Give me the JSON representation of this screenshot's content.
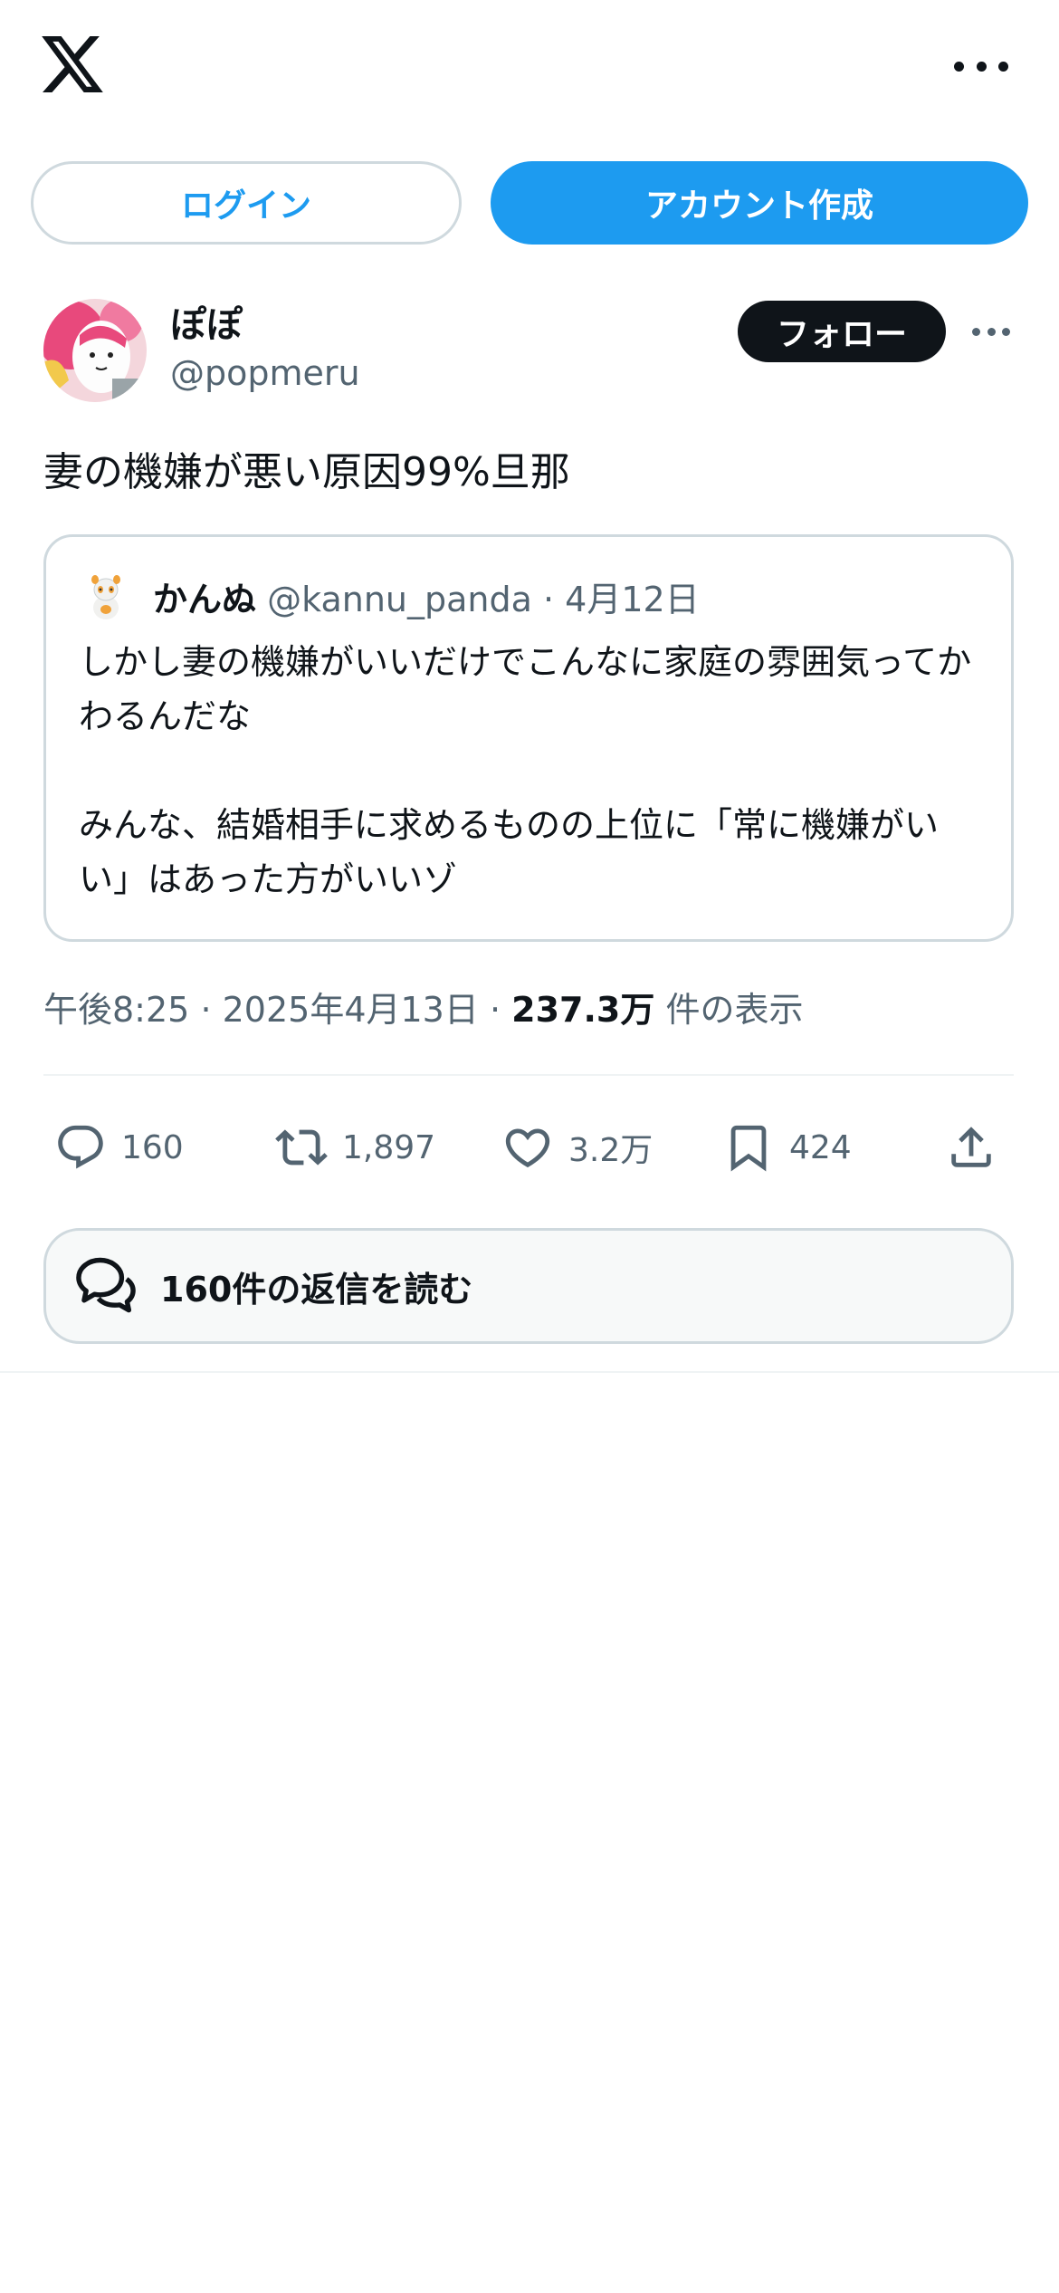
{
  "auth": {
    "login_label": "ログイン",
    "signup_label": "アカウント作成"
  },
  "tweet": {
    "author": {
      "display_name": "ぽぽ",
      "handle": "@popmeru"
    },
    "follow_label": "フォロー",
    "text": "妻の機嫌が悪い原因99%旦那",
    "quote": {
      "display_name": "かんぬ",
      "handle": "@kannu_panda",
      "separator": "·",
      "date": "4月12日",
      "paragraphs": [
        "しかし妻の機嫌がいいだけでこんなに家庭の雰囲気ってかわるんだな",
        "みんな、結婚相手に求めるものの上位に「常に機嫌がいい」はあった方がいいゾ"
      ]
    },
    "meta": {
      "time": "午後8:25",
      "separator": "·",
      "date": "2025年4月13日",
      "views_count": "237.3万",
      "views_label": "件の表示"
    },
    "actions": {
      "replies": "160",
      "retweets": "1,897",
      "likes": "3.2万",
      "bookmarks": "424"
    },
    "read_replies_label": "160件の返信を読む"
  },
  "colors": {
    "accent": "#1d9bf0",
    "text_primary": "#0f1419",
    "text_secondary": "#536471",
    "border": "#cfd9de"
  },
  "icons": {
    "logo": "x-logo-icon",
    "more": "more-horizontal-icon",
    "reply": "reply-bubble-icon",
    "retweet": "retweet-icon",
    "like": "heart-icon",
    "bookmark": "bookmark-icon",
    "share": "share-upload-icon",
    "read_replies": "chat-bubbles-icon"
  }
}
